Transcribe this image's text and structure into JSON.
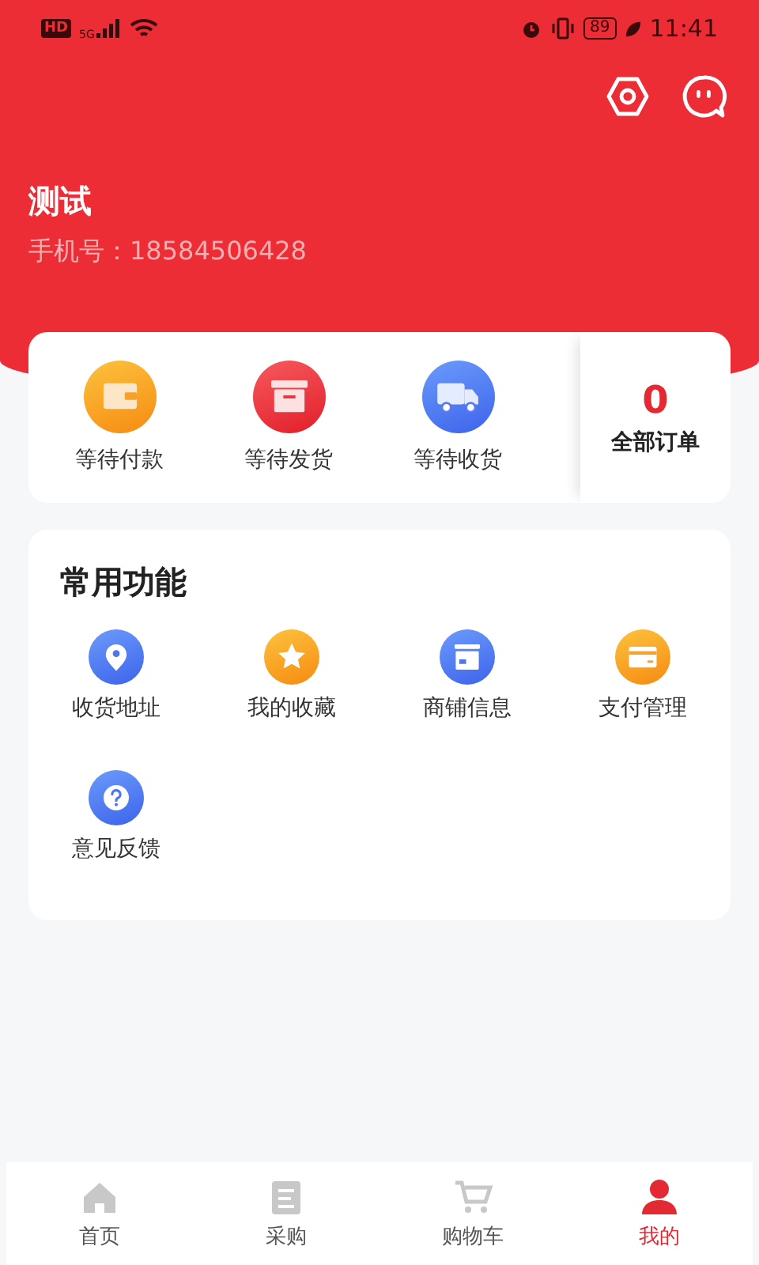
{
  "status_bar": {
    "hd": "HD",
    "network": "5G",
    "battery": "89",
    "time": "11:41"
  },
  "profile": {
    "name": "测试",
    "phone": "手机号：18584506428"
  },
  "orders": [
    {
      "kind": "wallet",
      "label": "等待付款"
    },
    {
      "kind": "box",
      "label": "等待发货"
    },
    {
      "kind": "truck",
      "label": "等待收货"
    }
  ],
  "all_orders": {
    "count": "0",
    "label": "全部订单"
  },
  "functions": {
    "title": "常用功能",
    "items": [
      {
        "kind": "pin",
        "label": "收货地址"
      },
      {
        "kind": "star",
        "label": "我的收藏"
      },
      {
        "kind": "shop",
        "label": "商铺信息"
      },
      {
        "kind": "card",
        "label": "支付管理"
      },
      {
        "kind": "help",
        "label": "意见反馈"
      }
    ]
  },
  "tabs": [
    {
      "kind": "home",
      "label": "首页",
      "selected": false
    },
    {
      "kind": "list",
      "label": "采购",
      "selected": false
    },
    {
      "kind": "cart",
      "label": "购物车",
      "selected": false
    },
    {
      "kind": "user",
      "label": "我的",
      "selected": true
    }
  ]
}
